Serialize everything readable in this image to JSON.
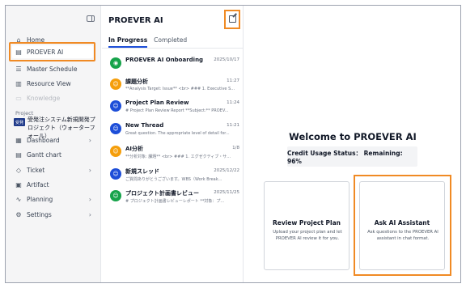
{
  "sidebar": {
    "items": [
      {
        "label": "Home",
        "icon": "home-icon"
      },
      {
        "label": "PROEVER AI",
        "icon": "ai-chat-icon"
      },
      {
        "label": "Master Schedule",
        "icon": "list-icon"
      },
      {
        "label": "Resource View",
        "icon": "bar-chart-icon"
      },
      {
        "label": "Knowledge",
        "icon": "book-icon"
      }
    ],
    "section_label": "Project",
    "project": {
      "badge": "受発",
      "name": "受発注システム新規開発プロジェクト（ウォーターフォール）"
    },
    "project_items": [
      {
        "label": "Dashboard",
        "icon": "dashboard-icon",
        "chevron": "›"
      },
      {
        "label": "Gantt chart",
        "icon": "gantt-icon",
        "chevron": ""
      },
      {
        "label": "Ticket",
        "icon": "ticket-icon",
        "chevron": "›"
      },
      {
        "label": "Artifact",
        "icon": "artifact-icon",
        "chevron": ""
      },
      {
        "label": "Planning",
        "icon": "planning-icon",
        "chevron": "›"
      },
      {
        "label": "Settings",
        "icon": "gear-icon",
        "chevron": "›"
      }
    ]
  },
  "chat_panel": {
    "title": "PROEVER AI",
    "tabs": [
      "In Progress",
      "Completed"
    ],
    "chats": [
      {
        "title": "PROEVER AI Onboarding",
        "date": "2025/10/17",
        "preview": "",
        "avatar_color": "#16a34a"
      },
      {
        "title": "課題分析",
        "date": "11:27",
        "preview": "**Analysis Target: Issue** <br> ### 1. Executive S...",
        "avatar_color": "#f59e0b"
      },
      {
        "title": "Project Plan Review",
        "date": "11:24",
        "preview": "# Project Plan Review Report **Subject:** PROEV...",
        "avatar_color": "#1d4ed8"
      },
      {
        "title": "New Thread",
        "date": "11:21",
        "preview": "Great question. The appropriate level of detail for...",
        "avatar_color": "#1d4ed8"
      },
      {
        "title": "AI分析",
        "date": "1/8",
        "preview": "**分析対象: 課題** <br> ### 1. エグゼクティブ・サ...",
        "avatar_color": "#f59e0b"
      },
      {
        "title": "新規スレッド",
        "date": "2025/12/22",
        "preview": "ご質問ありがとうございます。WBS（Work Break...",
        "avatar_color": "#1d4ed8"
      },
      {
        "title": "プロジェクト計画書レビュー",
        "date": "2025/11/25",
        "preview": "# プロジェクト計画書レビューレポート **対象：プ...",
        "avatar_color": "#16a34a"
      }
    ]
  },
  "main": {
    "welcome": "Welcome to PROEVER AI",
    "credit_status": "Credit Usage Status：  Remaining: 96%",
    "cards": [
      {
        "title": "Review Project Plan",
        "desc": "Upload your project plan and let PROEVER AI review it for you."
      },
      {
        "title": "Ask AI Assistant",
        "desc": "Ask questions to the PROEVER AI assistant in chat format."
      }
    ]
  },
  "colors": {
    "highlight": "#f08a24",
    "accent": "#1d4ed8"
  }
}
